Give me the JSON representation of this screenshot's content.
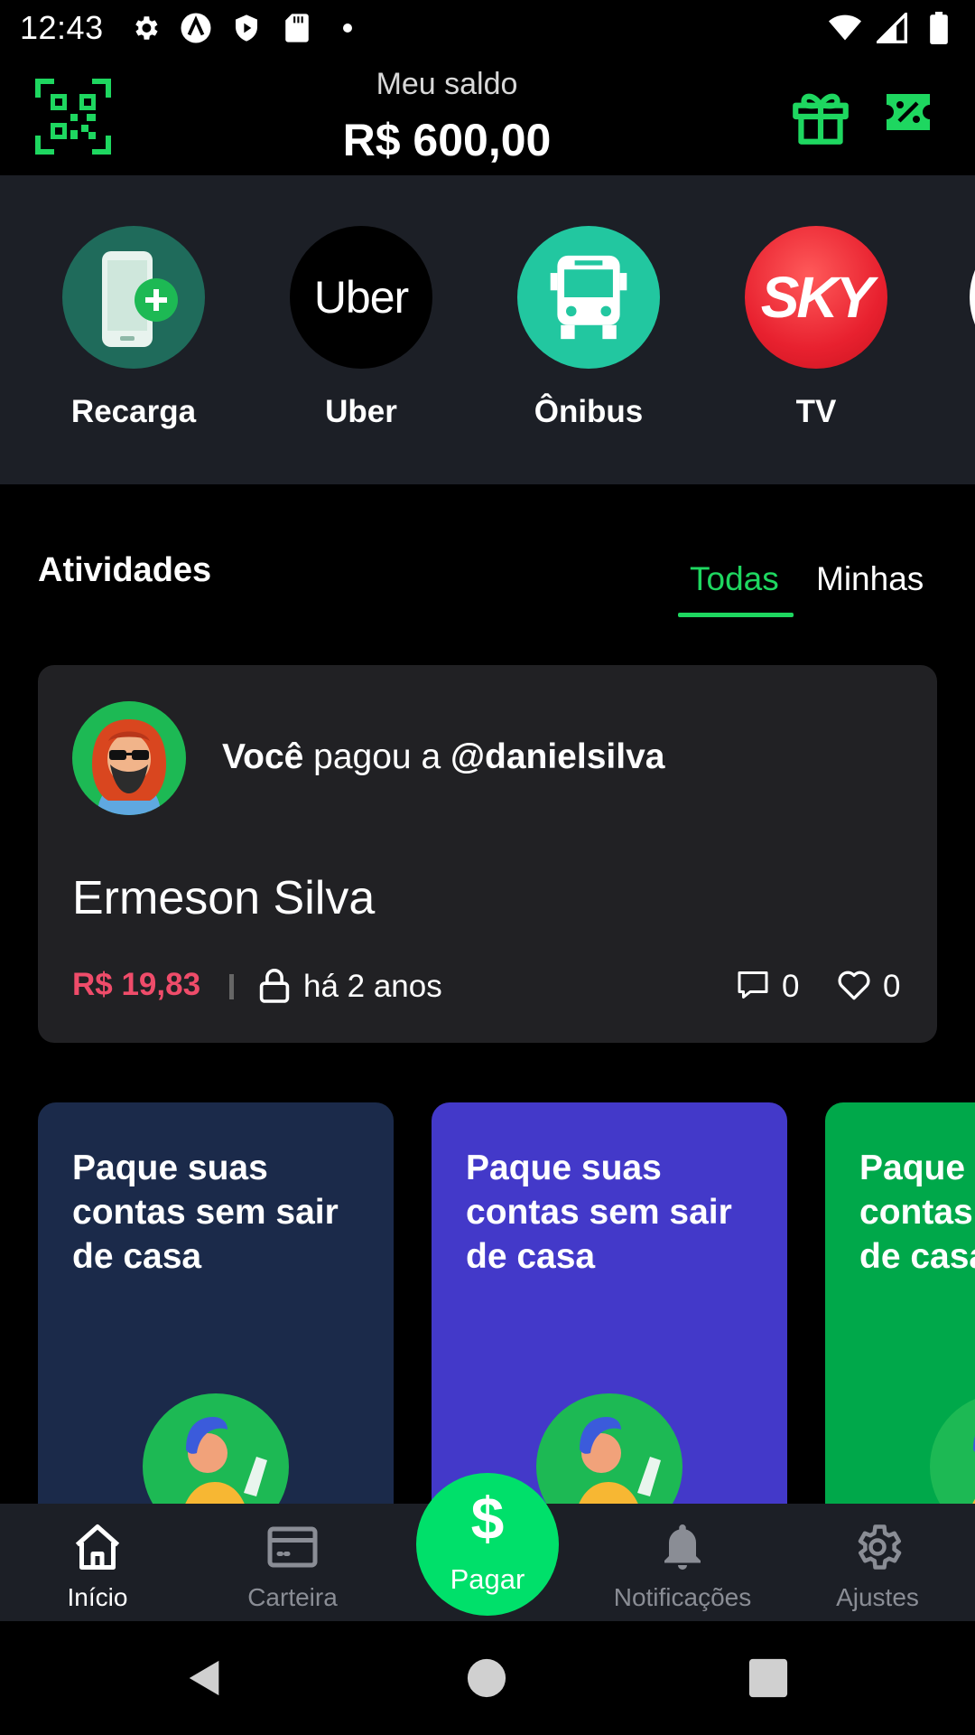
{
  "status_bar": {
    "time": "12:43"
  },
  "header": {
    "balance_label": "Meu saldo",
    "balance_value": "R$ 600,00"
  },
  "shortcuts": [
    {
      "label": "Recarga",
      "color": "#1f6b5b"
    },
    {
      "label": "Uber",
      "logo_text": "Uber",
      "color": "#000000"
    },
    {
      "label": "Ônibus",
      "color": "#22c7a0"
    },
    {
      "label": "TV",
      "logo_text": "SKY",
      "color": "#e8212f"
    }
  ],
  "activities": {
    "title": "Atividades",
    "tabs": [
      {
        "label": "Todas",
        "active": true
      },
      {
        "label": "Minhas",
        "active": false
      }
    ],
    "item": {
      "actor": "Você",
      "verb": " pagou a ",
      "target": "@danielsilva",
      "name": "Ermeson Silva",
      "amount": "R$ 19,83",
      "time": "há 2 anos",
      "comments": "0",
      "likes": "0"
    }
  },
  "promos": [
    {
      "text": "Paque suas contas sem sair de casa",
      "color": "#1b2a4a"
    },
    {
      "text": "Paque suas contas sem sair de casa",
      "color": "#4339c9"
    },
    {
      "text": "Paque suas contas sem sair de casa",
      "color": "#00a84a"
    }
  ],
  "nav": {
    "items": [
      {
        "label": "Início",
        "icon": "home-icon",
        "active": true
      },
      {
        "label": "Carteira",
        "icon": "wallet-icon",
        "active": false
      },
      {
        "label": "Notificações",
        "icon": "bell-icon",
        "active": false
      },
      {
        "label": "Ajustes",
        "icon": "gear-icon",
        "active": false
      }
    ],
    "pay_symbol": "$",
    "pay_label": "Pagar"
  },
  "colors": {
    "accent": "#1ed760",
    "amount": "#ef4c6a",
    "surface": "#1c1f26",
    "card": "#212124"
  }
}
